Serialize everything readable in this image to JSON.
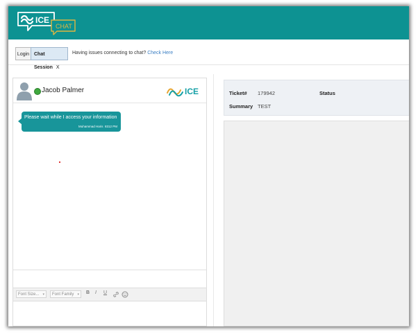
{
  "header": {
    "logo_text": "ICE",
    "logo_sub": "CHAT",
    "bg_color": "#0d9292"
  },
  "tabs": {
    "login": "Login",
    "chat_session": "Chat Session",
    "close": "X"
  },
  "notice": {
    "text": "Having issues connecting to chat?",
    "link": "Check Here"
  },
  "agent": {
    "name": "Jacob Palmer",
    "status_color": "#3fa83f",
    "brand_text": "ICE"
  },
  "messages": [
    {
      "text": "Please wait while I access your information",
      "sender": "Muhammad Haris",
      "time": "8312 PM"
    }
  ],
  "editor": {
    "font_size": "Font Size...",
    "font_family": "Font Family",
    "bold": "B",
    "italic": "I",
    "underline": "U"
  },
  "ticket": {
    "number_label": "Ticket#",
    "number_value": "179942",
    "status_label": "Status",
    "summary_label": "Summary",
    "summary_value": "TEST"
  }
}
